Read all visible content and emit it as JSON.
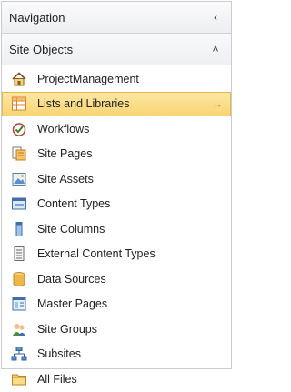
{
  "header": {
    "title": "Navigation",
    "collapse_icon": "chevron-left-icon"
  },
  "section": {
    "title": "Site Objects",
    "collapse_icon": "chevron-up-icon"
  },
  "items": [
    {
      "label": "ProjectManagement",
      "icon": "home-icon"
    },
    {
      "label": "Lists and Libraries",
      "icon": "lists-libraries-icon",
      "selected": true
    },
    {
      "label": "Workflows",
      "icon": "workflow-icon"
    },
    {
      "label": "Site Pages",
      "icon": "site-pages-icon"
    },
    {
      "label": "Site Assets",
      "icon": "site-assets-icon"
    },
    {
      "label": "Content Types",
      "icon": "content-types-icon"
    },
    {
      "label": "Site Columns",
      "icon": "site-columns-icon"
    },
    {
      "label": "External Content Types",
      "icon": "external-content-types-icon"
    },
    {
      "label": "Data Sources",
      "icon": "data-sources-icon"
    },
    {
      "label": "Master Pages",
      "icon": "master-pages-icon"
    },
    {
      "label": "Site Groups",
      "icon": "site-groups-icon"
    },
    {
      "label": "Subsites",
      "icon": "subsites-icon"
    },
    {
      "label": "All Files",
      "icon": "all-files-icon"
    }
  ]
}
